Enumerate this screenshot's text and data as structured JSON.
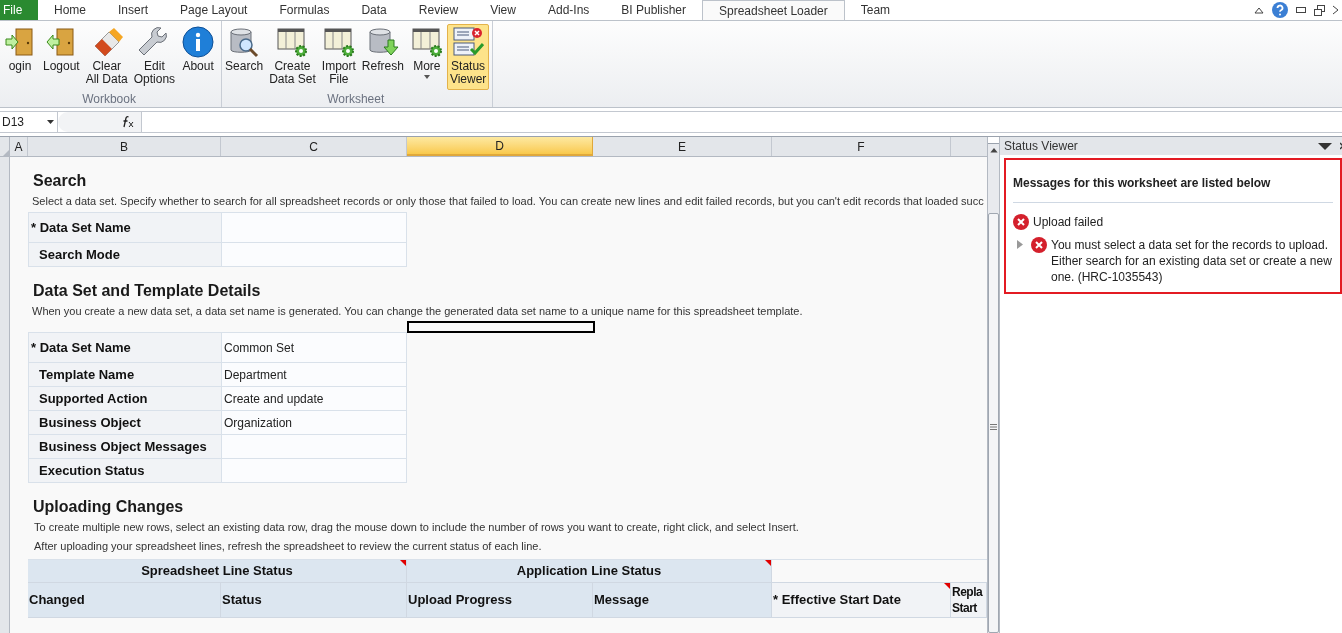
{
  "tabs": [
    {
      "label": "File",
      "kind": "file",
      "selected": false
    },
    {
      "label": "Home",
      "kind": "tab",
      "selected": false
    },
    {
      "label": "Insert",
      "kind": "tab",
      "selected": false
    },
    {
      "label": "Page Layout",
      "kind": "tab",
      "selected": false
    },
    {
      "label": "Formulas",
      "kind": "tab",
      "selected": false
    },
    {
      "label": "Data",
      "kind": "tab",
      "selected": false
    },
    {
      "label": "Review",
      "kind": "tab",
      "selected": false
    },
    {
      "label": "View",
      "kind": "tab",
      "selected": false
    },
    {
      "label": "Add-Ins",
      "kind": "tab",
      "selected": false
    },
    {
      "label": "BI Publisher",
      "kind": "tab",
      "selected": false
    },
    {
      "label": "Spreadsheet Loader",
      "kind": "tab",
      "selected": true
    },
    {
      "label": "Team",
      "kind": "tab",
      "selected": false
    }
  ],
  "ribbon": {
    "groups": [
      {
        "label": "Workbook",
        "buttons": [
          {
            "label": "ogin",
            "dropdown": false,
            "selected": false
          },
          {
            "label": "Logout",
            "dropdown": false,
            "selected": false
          },
          {
            "label": "Clear\nAll Data",
            "dropdown": false,
            "selected": false
          },
          {
            "label": "Edit\nOptions",
            "dropdown": false,
            "selected": false
          },
          {
            "label": "About",
            "dropdown": false,
            "selected": false
          }
        ]
      },
      {
        "label": "Worksheet",
        "buttons": [
          {
            "label": "Search",
            "dropdown": false,
            "selected": false
          },
          {
            "label": "Create\nData Set",
            "dropdown": false,
            "selected": false
          },
          {
            "label": "Import\nFile",
            "dropdown": false,
            "selected": false
          },
          {
            "label": "Refresh",
            "dropdown": false,
            "selected": false
          },
          {
            "label": "More",
            "dropdown": true,
            "selected": false
          },
          {
            "label": "Status\nViewer",
            "dropdown": false,
            "selected": true
          }
        ]
      }
    ]
  },
  "name_box": "D13",
  "columns": [
    {
      "label": "A",
      "selected": false
    },
    {
      "label": "B",
      "selected": false
    },
    {
      "label": "C",
      "selected": false
    },
    {
      "label": "D",
      "selected": true
    },
    {
      "label": "E",
      "selected": false
    },
    {
      "label": "F",
      "selected": false
    }
  ],
  "sections": [
    {
      "kind": "form",
      "title": "Search",
      "notes": [
        "Select a data set. Specify whether to search for all spreadsheet records or only those that failed to load. You can create new lines and edit failed records, but you can't edit records that loaded succ"
      ],
      "fields": [
        {
          "label": "* Data Set Name"
        },
        {
          "label": "Search Mode"
        }
      ]
    },
    {
      "kind": "form",
      "title": "Data Set and Template Details",
      "notes": [
        "When you create a new data set, a data set name is generated. You can change the generated data set name to a unique name for this spreadsheet template."
      ],
      "fields": [
        {
          "label": "* Data Set Name",
          "value": "Common Set"
        },
        {
          "label": "Template Name",
          "value": "Department"
        },
        {
          "label": "Supported Action",
          "value": "Create and update"
        },
        {
          "label": "Business Object",
          "value": "Organization"
        },
        {
          "label": "Business Object Messages"
        },
        {
          "label": "Execution Status"
        }
      ]
    },
    {
      "kind": "grid",
      "title": "Uploading Changes",
      "notes": [
        "To create multiple new rows, select an existing data row, drag the mouse down to include the number of rows you want to create, right click, and select Insert.",
        "After uploading your spreadsheet lines, refresh the spreadsheet to review the current status of each line."
      ],
      "header_groups": [
        {
          "label": "Spreadsheet Line Status",
          "comment": true
        },
        {
          "label": "Application Line Status",
          "comment": true
        }
      ],
      "grid_columns": [
        {
          "label": "Changed",
          "comment": false
        },
        {
          "label": "Status",
          "comment": false
        },
        {
          "label": "Upload Progress",
          "comment": false
        },
        {
          "label": "Message",
          "comment": false
        },
        {
          "label": "* Effective Start Date",
          "comment": true
        },
        {
          "label": "Repla\nStart",
          "comment": false
        }
      ]
    }
  ],
  "status_viewer": {
    "title": "Status Viewer",
    "heading": "Messages for this worksheet are listed below",
    "messages": [
      {
        "text": "Upload failed",
        "children": [
          {
            "text": "You must select a data set for the records to upload. Either search for an existing data set or create a new one. (HRC-1035543)",
            "expanded": false
          }
        ]
      }
    ]
  }
}
